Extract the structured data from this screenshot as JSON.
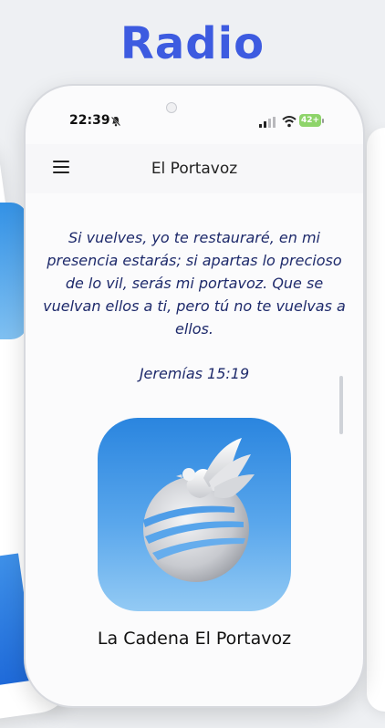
{
  "headline": "Radio",
  "status_bar": {
    "time": "22:39",
    "battery": "42+"
  },
  "app_bar": {
    "title": "El Portavoz"
  },
  "main": {
    "verse": "Si vuelves, yo te restauraré, en mi presencia estarás; si apartas lo precioso de lo vil, serás mi portavoz. Que se vuelvan ellos a ti, pero tú no te vuelvas a ellos.",
    "reference": "Jeremías 15:19",
    "station_name": "La Cadena El Portavoz"
  },
  "colors": {
    "headline": "#3d5be0",
    "verse_text": "#1e2a6b",
    "logo_top": "#2a85df",
    "logo_bottom": "#93caf4",
    "battery": "#8ed46a"
  },
  "icons": [
    "bell-slash-icon",
    "signal-icon",
    "wifi-icon",
    "battery-icon",
    "menu-icon",
    "dove-globe-logo"
  ]
}
